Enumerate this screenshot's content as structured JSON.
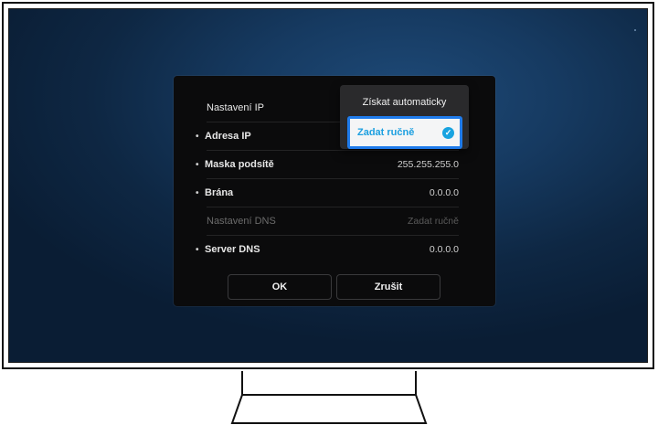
{
  "dialog": {
    "header": {
      "label": "Nastavení IP"
    },
    "rows": [
      {
        "label": "Adresa IP",
        "value": ""
      },
      {
        "label": "Maska podsítě",
        "value": "255.255.255.0"
      },
      {
        "label": "Brána",
        "value": "0.0.0.0"
      }
    ],
    "dns_header": {
      "label": "Nastavení DNS",
      "value": "Zadat ručně"
    },
    "dns_row": {
      "label": "Server DNS",
      "value": "0.0.0.0"
    },
    "buttons": {
      "ok": "OK",
      "cancel": "Zrušit"
    }
  },
  "popup": {
    "options": [
      {
        "label": "Získat automaticky"
      },
      {
        "label": "Zadat ručně",
        "selected": true
      }
    ],
    "check_icon": "check-circle-icon",
    "accent_color": "#1b9fe0",
    "focus_border_color": "#1f7bea"
  },
  "colors": {
    "screen_background": "#163a61",
    "dialog_background": "#0b0b0c"
  }
}
